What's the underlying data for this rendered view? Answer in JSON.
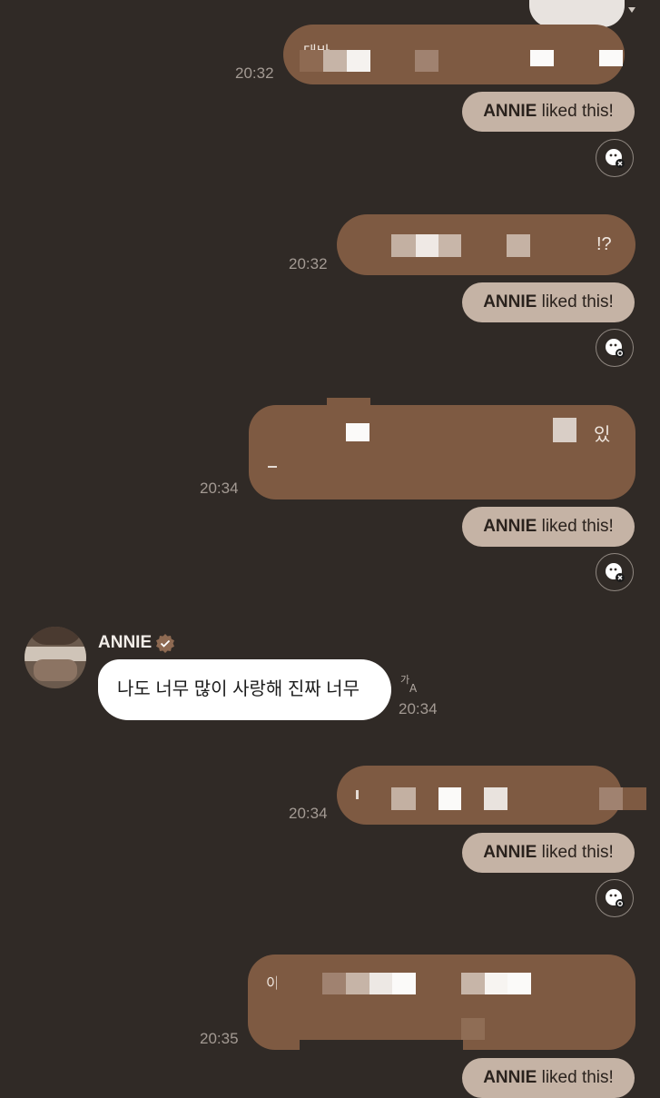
{
  "messages": [
    {
      "time": "20:32",
      "liked_name": "ANNIE",
      "liked_suffix": " liked this!",
      "reaction_icon": "emoji-reaction-icon"
    },
    {
      "time": "20:32",
      "liked_name": "ANNIE",
      "liked_suffix": " liked this!",
      "reaction_icon": "emoji-reaction-icon"
    },
    {
      "time": "20:34",
      "liked_name": "ANNIE",
      "liked_suffix": " liked this!",
      "reaction_icon": "emoji-reaction-icon"
    },
    {
      "time": "20:34",
      "liked_name": "ANNIE",
      "liked_suffix": " liked this!",
      "reaction_icon": "emoji-reaction-icon"
    },
    {
      "time": "20:35",
      "liked_name": "ANNIE",
      "liked_suffix": " liked this!"
    }
  ],
  "incoming": {
    "sender": "ANNIE",
    "verified_icon": "verified-check-icon",
    "text": "나도 너무 많이 사랑해 진짜 너무",
    "time": "20:34",
    "translate_icon": "translate-icon"
  },
  "fragments": {
    "m1": "대바",
    "m2": "!?",
    "m3": "있",
    "m5": "이"
  },
  "colors": {
    "background": "#302a26",
    "outgoing_bubble": "#7e5a42",
    "liked_pill": "#c5b3a5",
    "incoming_bubble": "#ffffff",
    "timestamp": "#a39a93"
  }
}
